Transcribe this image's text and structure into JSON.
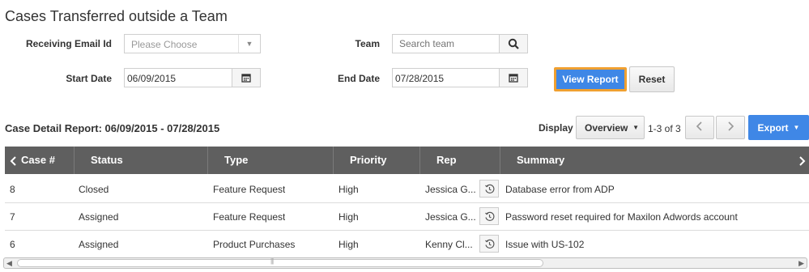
{
  "page": {
    "title": "Cases Transferred outside a Team"
  },
  "filters": {
    "receiving_email_label": "Receiving Email Id",
    "receiving_email_placeholder": "Please Choose",
    "team_label": "Team",
    "team_placeholder": "Search team",
    "start_date_label": "Start Date",
    "start_date_value": "06/09/2015",
    "end_date_label": "End Date",
    "end_date_value": "07/28/2015",
    "view_report_label": "View Report",
    "reset_label": "Reset"
  },
  "report": {
    "title": "Case Detail Report: 06/09/2015 - 07/28/2015",
    "display_label": "Display",
    "display_value": "Overview",
    "pagination_text": "1-3 of 3",
    "export_label": "Export"
  },
  "table": {
    "columns": [
      "Case #",
      "Status",
      "Type",
      "Priority",
      "Rep",
      "Summary"
    ],
    "rows": [
      {
        "case": "8",
        "status": "Closed",
        "type": "Feature Request",
        "priority": "High",
        "rep": "Jessica G...",
        "summary": "Database error from ADP"
      },
      {
        "case": "7",
        "status": "Assigned",
        "type": "Feature Request",
        "priority": "High",
        "rep": "Jessica G...",
        "summary": "Password reset required for Maxilon Adwords account"
      },
      {
        "case": "6",
        "status": "Assigned",
        "type": "Product Purchases",
        "priority": "High",
        "rep": "Kenny Cl...",
        "summary": "Issue with US-102"
      }
    ]
  },
  "icons": {
    "search": "search-icon",
    "calendar": "calendar-icon",
    "history": "history-icon",
    "caret_down": "caret-down-icon",
    "chevron_left": "chevron-left-icon",
    "chevron_right": "chevron-right-icon"
  },
  "colors": {
    "primary": "#3f87e6",
    "focus_ring": "#f0a030",
    "table_header": "#5f5f5f"
  }
}
